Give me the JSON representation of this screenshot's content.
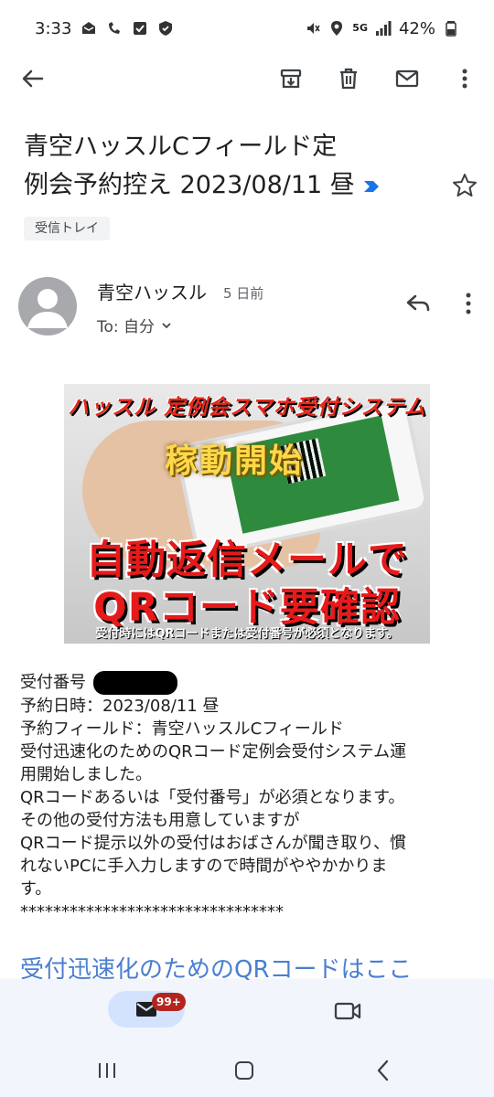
{
  "status_bar": {
    "time": "3:33",
    "battery": "42%",
    "network": "5G"
  },
  "app_bar": {
    "icons": [
      "back-arrow-icon",
      "archive-icon",
      "delete-icon",
      "mail-icon",
      "more-vert-icon"
    ]
  },
  "email": {
    "subject_line1": "青空ハッスルCフィールド定",
    "subject_line2": "例会予約控え 2023/08/11 昼",
    "label": "受信トレイ",
    "sender": "青空ハッスル",
    "time_ago": "5 日前",
    "to": "To: 自分"
  },
  "banner": {
    "title": "ハッスル 定例会スマホ受付システム",
    "kado": "稼動開始",
    "main_line1": "自動返信メールで",
    "main_line2": "QRコード要確認",
    "note": "受付時にはQRコードまたは受付番号が必須となります。"
  },
  "body": {
    "line1": "受付番号",
    "line2": "予約日時：2023/08/11 昼",
    "line3": "予約フィールド：青空ハッスルCフィールド",
    "line4": "受付迅速化のためのQRコード定例会受付システム運",
    "line5": "用開始しました。",
    "line6": "QRコードあるいは「受付番号」が必須となります。",
    "line7": "その他の受付方法も用意していますが",
    "line8": "QRコード提示以外の受付はおばさんが聞き取り、慣",
    "line9": "れないPCに手入力しますので時間がややかかりま",
    "line10": "す。",
    "line11": "********************************",
    "link": "受付迅速化のためのQRコードはここ"
  },
  "bottom_nav": {
    "mail_badge": "99+"
  },
  "colors": {
    "accent": "#4a7fd0",
    "nav_bg": "#f2f6fc",
    "nav_active": "#d3e3fd",
    "badge": "#b3261e"
  }
}
